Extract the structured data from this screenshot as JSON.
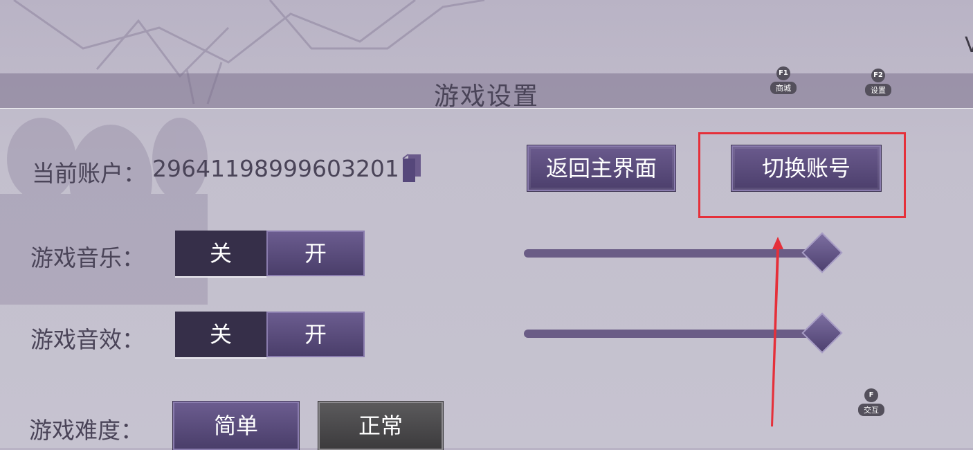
{
  "header": {
    "title": "游戏设置"
  },
  "hotkeys": [
    {
      "key": "F1",
      "label": "商城"
    },
    {
      "key": "F2",
      "label": "设置"
    },
    {
      "key": "F",
      "label": "交互"
    }
  ],
  "account": {
    "label": "当前账户：",
    "id": "29641198999603201",
    "copy_icon": "copy-icon"
  },
  "buttons": {
    "home": "返回主界面",
    "switch_account": "切换账号"
  },
  "music": {
    "label": "游戏音乐：",
    "off": "关",
    "on": "开",
    "selected": "开",
    "volume_fraction": 0.98
  },
  "sfx": {
    "label": "游戏音效：",
    "off": "关",
    "on": "开",
    "selected": "开",
    "volume_fraction": 0.98
  },
  "difficulty": {
    "label": "游戏难度：",
    "options": [
      "简单",
      "正常"
    ],
    "selected": "简单"
  },
  "colors": {
    "accent": "#5a4c7c",
    "highlight_annotation": "#e5303a"
  }
}
